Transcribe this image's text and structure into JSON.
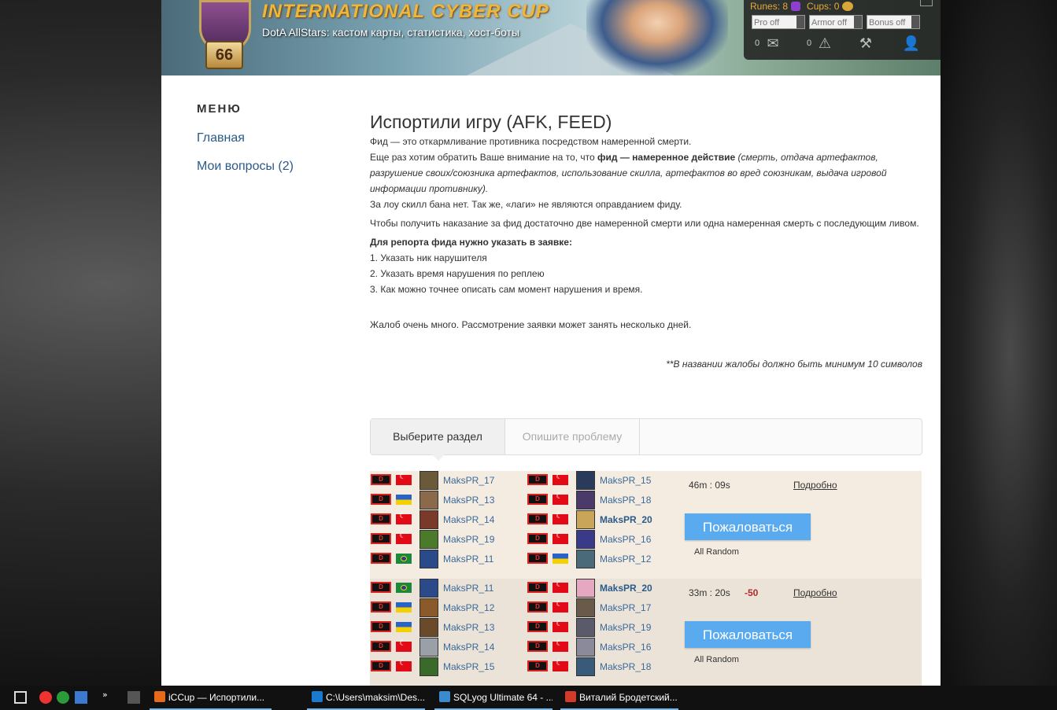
{
  "header": {
    "title": "INTERNATIONAL CYBER CUP",
    "subtitle": "DotA AllStars: кастом карты, статистика, хост-боты",
    "level": "66",
    "runes_label": "Runes: 8",
    "cups_label": "Cups: 0",
    "toggles": [
      "Pro off",
      "Armor off",
      "Bonus off"
    ],
    "messages_count": "0",
    "alerts_count": "0",
    "icons": [
      "mail-icon",
      "warning-icon",
      "tools-icon",
      "user-icon"
    ]
  },
  "menu": {
    "title": "МЕНЮ",
    "items": [
      "Главная",
      "Мои вопросы (2)"
    ]
  },
  "content": {
    "heading": "Испортили игру (AFK, FEED)",
    "p1": "Фид — это откармливание противника посредством намеренной смерти.",
    "p2_a": "Еще раз хотим обратить Ваше внимание на то, что ",
    "p2_b": "фид — намеренное действие",
    "p2_c": " (смерть, отдача артефактов, разрушение своих/союзника артефактов, использование скилла, артефактов во вред союзникам, выдача игровой информации противнику).",
    "p3": "За лоу скилл бана нет. Так же, «лаги» не являются оправданием фиду.",
    "p4": "Чтобы получить наказание за фид достаточно две намеренной смерти или одна намеренная смерть с последующим ливом.",
    "p5_title": "Для репорта фида нужно указать в заявке:",
    "steps": [
      "1. Указать ник нарушителя",
      "2. Указать время нарушения по реплею",
      "3. Как можно точнее описать сам момент нарушения и время."
    ],
    "p6": "Жалоб очень много. Рассмотрение заявки может занять несколько дней.",
    "note": "**В названии жалобы должно быть минимум 10 символов"
  },
  "tabs": [
    "Выберите раздел",
    "Опишите проблему"
  ],
  "games": [
    {
      "time": "46m : 09s",
      "points": "",
      "more": "Подробно",
      "button": "Пожаловаться",
      "mode": "All Random",
      "left": [
        {
          "name": "MaksPR_17",
          "flag": "tr",
          "bold": false,
          "hero": "#6a5a3a"
        },
        {
          "name": "MaksPR_13",
          "flag": "ua",
          "bold": false,
          "hero": "#8a6a4a"
        },
        {
          "name": "MaksPR_14",
          "flag": "tr",
          "bold": false,
          "hero": "#7a3a2a"
        },
        {
          "name": "MaksPR_19",
          "flag": "tr",
          "bold": false,
          "hero": "#4a7a2a"
        },
        {
          "name": "MaksPR_11",
          "flag": "br",
          "bold": false,
          "hero": "#2a4a8a"
        }
      ],
      "right": [
        {
          "name": "MaksPR_15",
          "flag": "tr",
          "bold": false,
          "hero": "#2a3a5a"
        },
        {
          "name": "MaksPR_18",
          "flag": "tr",
          "bold": false,
          "hero": "#4a3a6a"
        },
        {
          "name": "MaksPR_20",
          "flag": "tr",
          "bold": true,
          "hero": "#c9a55a"
        },
        {
          "name": "MaksPR_16",
          "flag": "tr",
          "bold": false,
          "hero": "#3a3a8a"
        },
        {
          "name": "MaksPR_12",
          "flag": "ua",
          "bold": false,
          "hero": "#4a6a7a"
        }
      ]
    },
    {
      "time": "33m : 20s",
      "points": "-50",
      "more": "Подробно",
      "button": "Пожаловаться",
      "mode": "All Random",
      "left": [
        {
          "name": "MaksPR_11",
          "flag": "br",
          "bold": false,
          "hero": "#2a4a8a"
        },
        {
          "name": "MaksPR_12",
          "flag": "ua",
          "bold": false,
          "hero": "#8a5a2a"
        },
        {
          "name": "MaksPR_13",
          "flag": "ua",
          "bold": false,
          "hero": "#6a4a2a"
        },
        {
          "name": "MaksPR_14",
          "flag": "tr",
          "bold": false,
          "hero": "#9aa0a8"
        },
        {
          "name": "MaksPR_15",
          "flag": "tr",
          "bold": false,
          "hero": "#3a6a2a"
        }
      ],
      "right": [
        {
          "name": "MaksPR_20",
          "flag": "tr",
          "bold": true,
          "hero": "#e6a8c0"
        },
        {
          "name": "MaksPR_17",
          "flag": "tr",
          "bold": false,
          "hero": "#6a5a4a"
        },
        {
          "name": "MaksPR_19",
          "flag": "tr",
          "bold": false,
          "hero": "#5a5a6a"
        },
        {
          "name": "MaksPR_16",
          "flag": "tr",
          "bold": false,
          "hero": "#8a8a9a"
        },
        {
          "name": "MaksPR_18",
          "flag": "tr",
          "bold": false,
          "hero": "#3a5a7a"
        }
      ]
    }
  ],
  "taskbar": {
    "items": [
      {
        "label": "iCCup — Испортили...",
        "color": "#e66a1a"
      },
      {
        "label": "C:\\Users\\maksim\\Des...",
        "color": "#1a7ad0"
      },
      {
        "label": "SQLyog Ultimate 64 - ...",
        "color": "#3a8ad0"
      },
      {
        "label": "Виталий Бродетский...",
        "color": "#d23a2a"
      }
    ]
  }
}
